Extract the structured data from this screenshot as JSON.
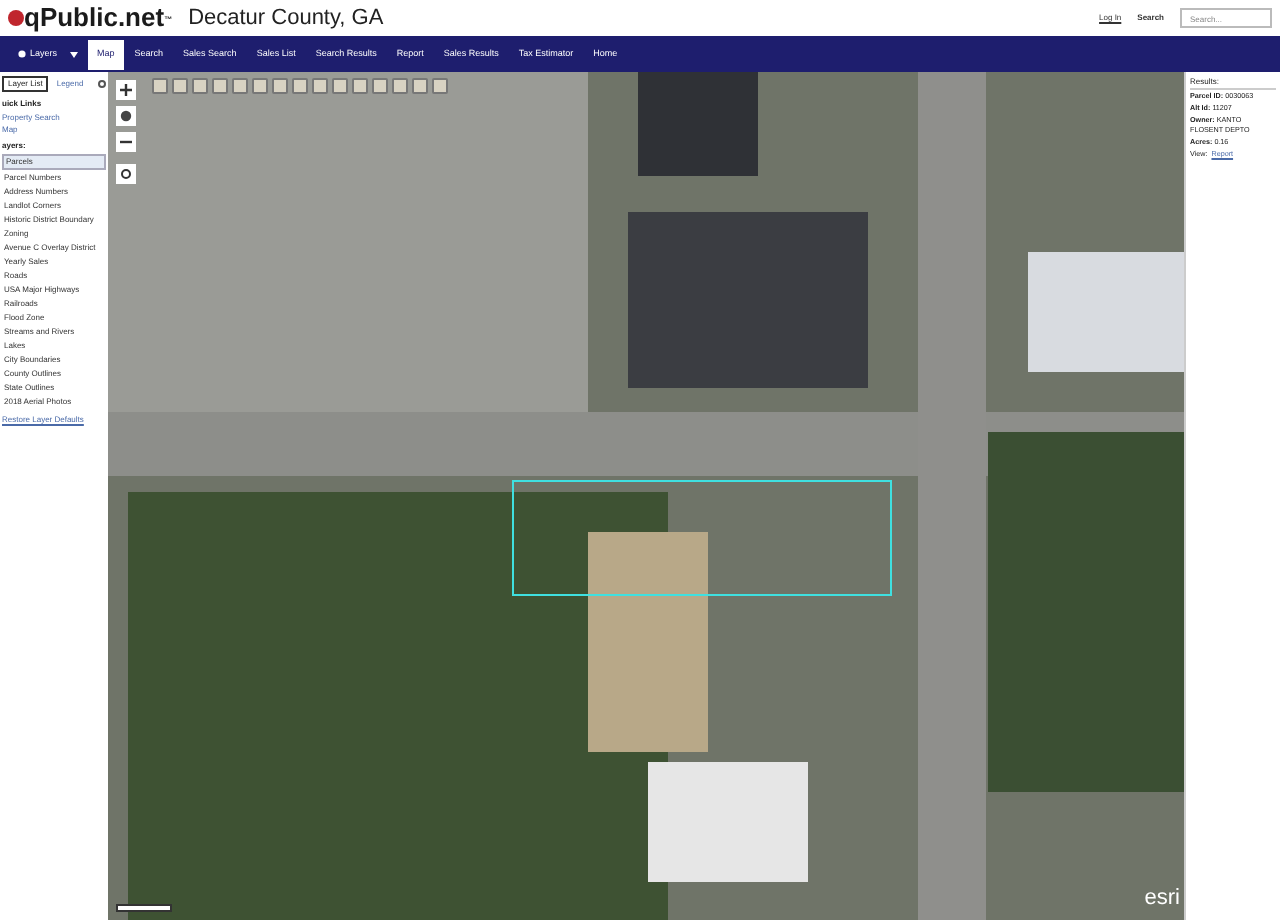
{
  "header": {
    "logo": "qPublic.net",
    "trademark": "™",
    "county": "Decatur County, GA",
    "login": "Log In",
    "search_label": "Search",
    "search_placeholder": "Search..."
  },
  "nav": [
    {
      "label": "Layers",
      "kind": "dropdown",
      "selected": false
    },
    {
      "label": "Map",
      "kind": "tab",
      "selected": true
    },
    {
      "label": "Search",
      "kind": "tab",
      "selected": false
    },
    {
      "label": "Sales Search",
      "kind": "tab",
      "selected": false
    },
    {
      "label": "Sales List",
      "kind": "tab",
      "selected": false
    },
    {
      "label": "Search Results",
      "kind": "tab",
      "selected": false
    },
    {
      "label": "Report",
      "kind": "tab",
      "selected": false
    },
    {
      "label": "Sales Results",
      "kind": "tab",
      "selected": false
    },
    {
      "label": "Tax Estimator",
      "kind": "tab",
      "selected": false
    },
    {
      "label": "Home",
      "kind": "tab",
      "selected": false
    }
  ],
  "sidebar": {
    "tabs": [
      {
        "label": "Layer List",
        "selected": true
      },
      {
        "label": "Legend",
        "selected": false
      }
    ],
    "quick_links_title": "uick Links",
    "quick_links": [
      "Property Search",
      "Map"
    ],
    "layers_title": "ayers:",
    "layers": [
      {
        "label": "Parcels",
        "selected": true
      },
      {
        "label": "Parcel Numbers",
        "selected": false
      },
      {
        "label": "Address Numbers",
        "selected": false
      },
      {
        "label": "Landlot Corners",
        "selected": false
      },
      {
        "label": "Historic District Boundary",
        "selected": false
      },
      {
        "label": "Zoning",
        "selected": false
      },
      {
        "label": "Avenue C Overlay District",
        "selected": false
      },
      {
        "label": "Yearly Sales",
        "selected": false
      },
      {
        "label": "Roads",
        "selected": false
      },
      {
        "label": "USA Major Highways",
        "selected": false
      },
      {
        "label": "Railroads",
        "selected": false
      },
      {
        "label": "Flood Zone",
        "selected": false
      },
      {
        "label": "Streams and Rivers",
        "selected": false
      },
      {
        "label": "Lakes",
        "selected": false
      },
      {
        "label": "City Boundaries",
        "selected": false
      },
      {
        "label": "County Outlines",
        "selected": false
      },
      {
        "label": "State Outlines",
        "selected": false
      },
      {
        "label": "2018 Aerial Photos",
        "selected": false
      }
    ],
    "restore": "Restore Layer Defaults"
  },
  "map": {
    "attribution": "esri"
  },
  "results": {
    "title": "Results:",
    "fields": [
      {
        "label": "Parcel ID:",
        "value": "0030063"
      },
      {
        "label": "Alt Id:",
        "value": "11207"
      },
      {
        "label": "Owner:",
        "value": "KANTO FLOSENT DEPTO"
      },
      {
        "label": "Acres:",
        "value": "0.16"
      }
    ],
    "view_label": "View:",
    "view_link": "Report"
  }
}
